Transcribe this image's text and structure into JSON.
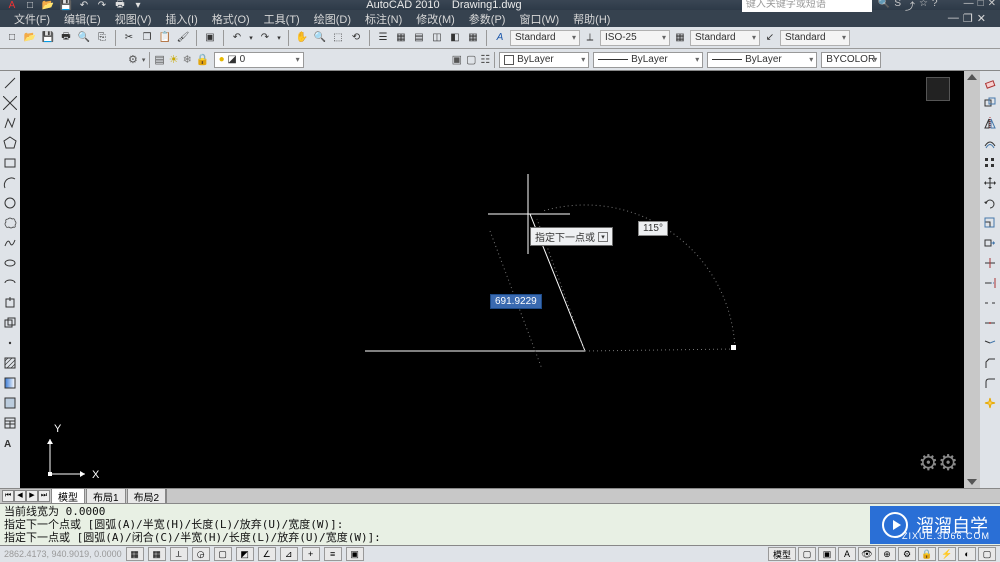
{
  "app": {
    "title": "AutoCAD 2010",
    "document": "Drawing1.dwg",
    "search_placeholder": "键入关键字或短语"
  },
  "menubar": {
    "items": [
      "文件(F)",
      "编辑(E)",
      "视图(V)",
      "插入(I)",
      "格式(O)",
      "工具(T)",
      "绘图(D)",
      "标注(N)",
      "修改(M)",
      "参数(P)",
      "窗口(W)",
      "帮助(H)"
    ]
  },
  "styles_toolbar": {
    "text_style": "Standard",
    "dim_style": "ISO-25",
    "table_style": "Standard",
    "mleader_style": "Standard"
  },
  "layers_toolbar": {
    "layer": "0",
    "current_layer_combo": "ByLayer",
    "linetype": "ByLayer",
    "lineweight": "ByLayer",
    "plot_style": "BYCOLOR"
  },
  "canvas": {
    "tooltip_label": "指定下一点或",
    "length_value": "691.9229",
    "angle_value": "115°",
    "ucs": {
      "x": "X",
      "y": "Y"
    }
  },
  "tabs": {
    "items": [
      "模型",
      "布局1",
      "布局2"
    ]
  },
  "command": {
    "line1": "当前线宽为  0.0000",
    "line2": "指定下一个点或 [圆弧(A)/半宽(H)/长度(L)/放弃(U)/宽度(W)]:",
    "line3": "指定下一点或 [圆弧(A)/闭合(C)/半宽(H)/长度(L)/放弃(U)/宽度(W)]:"
  },
  "statusbar": {
    "coords_dim": "2862.4173, 940.9019, 0.0000",
    "model_space": "模型"
  },
  "watermark": {
    "text": "溜溜自学",
    "url": "ZIXUE.3D66.COM"
  }
}
